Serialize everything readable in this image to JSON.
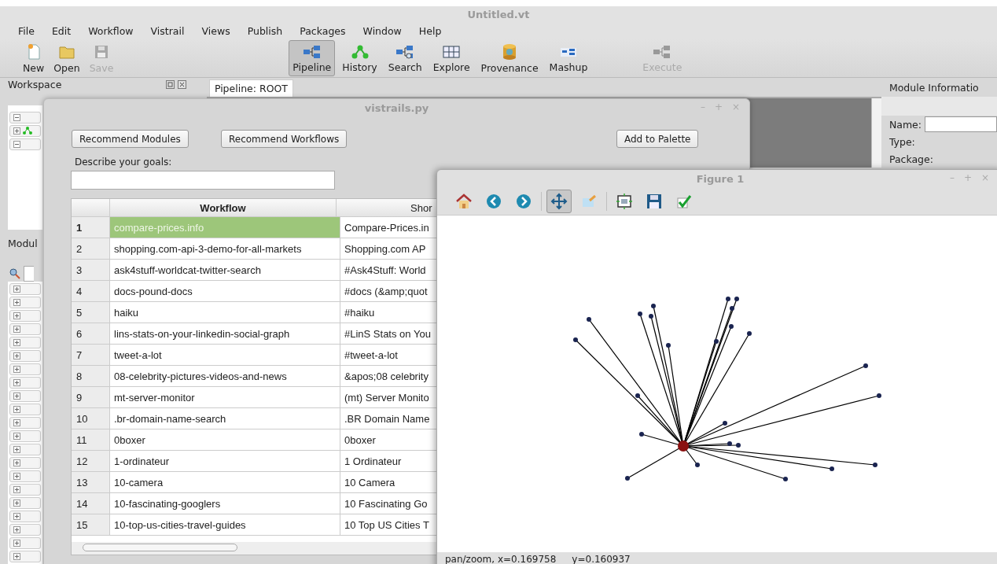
{
  "window": {
    "title": "Untitled.vt"
  },
  "menu": [
    "File",
    "Edit",
    "Workflow",
    "Vistrail",
    "Views",
    "Publish",
    "Packages",
    "Window",
    "Help"
  ],
  "toolbar": {
    "file": [
      {
        "label": "New",
        "disabled": false
      },
      {
        "label": "Open",
        "disabled": false
      },
      {
        "label": "Save",
        "disabled": true
      }
    ],
    "views": [
      {
        "label": "Pipeline",
        "selected": true
      },
      {
        "label": "History",
        "selected": false
      },
      {
        "label": "Search",
        "selected": false
      },
      {
        "label": "Explore",
        "selected": false
      },
      {
        "label": "Provenance",
        "selected": false
      },
      {
        "label": "Mashup",
        "selected": false
      }
    ],
    "execute": {
      "label": "Execute",
      "disabled": true
    }
  },
  "workspace": {
    "title": "Workspace",
    "modules_title": "Modul"
  },
  "pipeline_tab": {
    "label": "Pipeline: ROOT"
  },
  "module_info": {
    "title": "Module Informatio",
    "fields": [
      {
        "label": "Name:",
        "kind": "input"
      },
      {
        "label": "Type:",
        "kind": "text"
      },
      {
        "label": "Package:",
        "kind": "text"
      }
    ]
  },
  "dialog": {
    "title": "vistrails.py",
    "controls": [
      "–",
      "+",
      "×"
    ],
    "buttons": [
      "Recommend Modules",
      "Recommend Workflows",
      "Add to Palette"
    ],
    "goals_label": "Describe your goals:",
    "table": {
      "columns": [
        "Workflow",
        "Shor"
      ],
      "rows": [
        {
          "num": "1",
          "workflow": "compare-prices.info",
          "short": "Compare-Prices.in",
          "selected": true
        },
        {
          "num": "2",
          "workflow": "shopping.com-api-3-demo-for-all-markets",
          "short": "Shopping.com AP",
          "selected": false
        },
        {
          "num": "3",
          "workflow": "ask4stuff-worldcat-twitter-search",
          "short": "#Ask4Stuff: World",
          "selected": false
        },
        {
          "num": "4",
          "workflow": "docs-pound-docs",
          "short": "#docs (&amp;quot",
          "selected": false
        },
        {
          "num": "5",
          "workflow": "haiku",
          "short": "#haiku",
          "selected": false
        },
        {
          "num": "6",
          "workflow": "lins-stats-on-your-linkedin-social-graph",
          "short": "#LinS Stats on You",
          "selected": false
        },
        {
          "num": "7",
          "workflow": "tweet-a-lot",
          "short": "#tweet-a-lot",
          "selected": false
        },
        {
          "num": "8",
          "workflow": "08-celebrity-pictures-videos-and-news",
          "short": "&apos;08 celebrity",
          "selected": false
        },
        {
          "num": "9",
          "workflow": "mt-server-monitor",
          "short": "(mt) Server Monito",
          "selected": false
        },
        {
          "num": "10",
          "workflow": ".br-domain-name-search",
          "short": ".BR Domain Name",
          "selected": false
        },
        {
          "num": "11",
          "workflow": "0boxer",
          "short": "0boxer",
          "selected": false
        },
        {
          "num": "12",
          "workflow": "1-ordinateur",
          "short": "1 Ordinateur",
          "selected": false
        },
        {
          "num": "13",
          "workflow": "10-camera",
          "short": "10 Camera",
          "selected": false
        },
        {
          "num": "14",
          "workflow": "10-fascinating-googlers",
          "short": "10 Fascinating Go",
          "selected": false
        },
        {
          "num": "15",
          "workflow": "10-top-us-cities-travel-guides",
          "short": "10 Top US Cities T",
          "selected": false
        }
      ]
    }
  },
  "figure": {
    "title": "Figure 1",
    "controls": [
      "–",
      "+",
      "×"
    ],
    "tools": [
      {
        "selected": false
      },
      {
        "selected": false
      },
      {
        "selected": false
      },
      {
        "selected": true
      },
      {
        "selected": false
      },
      {
        "selected": false
      },
      {
        "selected": false
      },
      {
        "selected": false
      }
    ],
    "status": [
      "pan/zoom, x=0.169758",
      "y=0.160937"
    ]
  }
}
